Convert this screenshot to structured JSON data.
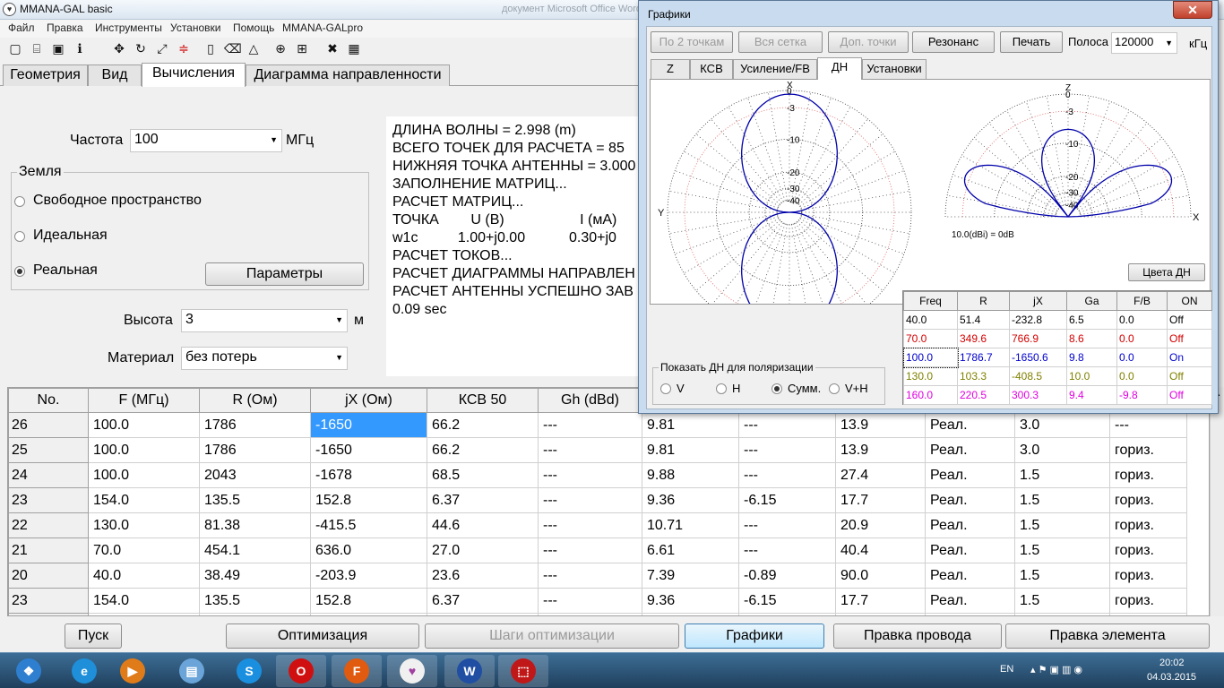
{
  "app": {
    "title": "MMANA-GAL basic",
    "ghost_title": "документ Microsoft Office Word",
    "icon_glyph": "♥"
  },
  "menu": [
    "Файл",
    "Правка",
    "Инструменты",
    "Установки",
    "Помощь",
    "MMANA-GALpro"
  ],
  "toolbar_icons": [
    "new-file-icon",
    "open-folder-icon",
    "save-icon",
    "info-icon",
    "move-icon",
    "rotate-icon",
    "resize-icon",
    "wire-edit-icon",
    "document-icon",
    "eraser-icon",
    "triangle-icon",
    "crosshair-icon",
    "tools-icon",
    "calculator-icon"
  ],
  "tabs": [
    {
      "label": "Геометрия",
      "active": false
    },
    {
      "label": "Вид",
      "active": false
    },
    {
      "label": "Вычисления",
      "active": true
    },
    {
      "label": "Диаграмма направленности",
      "active": false
    }
  ],
  "calc": {
    "freq_label": "Частота",
    "freq_value": "100",
    "freq_unit": "МГц",
    "ground_legend": "Земля",
    "ground_options": [
      {
        "label": "Свободное пространство",
        "selected": false
      },
      {
        "label": "Идеальная",
        "selected": false
      },
      {
        "label": "Реальная",
        "selected": true
      }
    ],
    "params_button": "Параметры",
    "height_label": "Высота",
    "height_value": "3",
    "height_unit": "м",
    "material_label": "Материал",
    "material_value": "без потерь"
  },
  "log_lines": [
    "ДЛИНА ВОЛНЫ = 2.998 (m)",
    "ВСЕГО ТОЧЕК ДЛЯ РАСЧЕТА = 85",
    "НИЖНЯЯ ТОЧКА АНТЕННЫ = 3.000",
    "ЗАПОЛНЕНИЕ МАТРИЦ...",
    "РАСЧЕТ МАТРИЦ...",
    "ТОЧКА        U (В)                   I (мА)",
    "w1c          1.00+j0.00           0.30+j0",
    "РАСЧЕТ ТОКОВ...",
    "РАСЧЕТ ДИАГРАММЫ НАПРАВЛЕН",
    "РАСЧЕТ АНТЕННЫ УСПЕШНО ЗАВ",
    "0.09 sec"
  ],
  "results": {
    "columns": [
      "No.",
      "F (МГц)",
      "R (Ом)",
      "jX (Ом)",
      "КСВ 50",
      "Gh (dBd)",
      "",
      "",
      "",
      "",
      "",
      ""
    ],
    "rows": [
      [
        "26",
        "100.0",
        "1786",
        "-1650",
        "66.2",
        "---",
        "9.81",
        "---",
        "13.9",
        "Реал.",
        "3.0",
        "---"
      ],
      [
        "25",
        "100.0",
        "1786",
        "-1650",
        "66.2",
        "---",
        "9.81",
        "---",
        "13.9",
        "Реал.",
        "3.0",
        "гориз."
      ],
      [
        "24",
        "100.0",
        "2043",
        "-1678",
        "68.5",
        "---",
        "9.88",
        "---",
        "27.4",
        "Реал.",
        "1.5",
        "гориз."
      ],
      [
        "23",
        "154.0",
        "135.5",
        "152.8",
        "6.37",
        "---",
        "9.36",
        "-6.15",
        "17.7",
        "Реал.",
        "1.5",
        "гориз."
      ],
      [
        "22",
        "130.0",
        "81.38",
        "-415.5",
        "44.6",
        "---",
        "10.71",
        "---",
        "20.9",
        "Реал.",
        "1.5",
        "гориз."
      ],
      [
        "21",
        "70.0",
        "454.1",
        "636.0",
        "27.0",
        "---",
        "6.61",
        "---",
        "40.4",
        "Реал.",
        "1.5",
        "гориз."
      ],
      [
        "20",
        "40.0",
        "38.49",
        "-203.9",
        "23.6",
        "---",
        "7.39",
        "-0.89",
        "90.0",
        "Реал.",
        "1.5",
        "гориз."
      ],
      [
        "23",
        "154.0",
        "135.5",
        "152.8",
        "6.37",
        "---",
        "9.36",
        "-6.15",
        "17.7",
        "Реал.",
        "1.5",
        "гориз."
      ],
      [
        "",
        "",
        "",
        "",
        "",
        "",
        "",
        "",
        "",
        "",
        "",
        ""
      ]
    ]
  },
  "bottom_buttons": [
    {
      "label": "Пуск",
      "disabled": false
    },
    {
      "label": "Оптимизация",
      "disabled": false
    },
    {
      "label": "Шаги оптимизации",
      "disabled": true
    },
    {
      "label": "Графики",
      "disabled": false
    },
    {
      "label": "Правка провода",
      "disabled": false
    },
    {
      "label": "Правка элемента",
      "disabled": false
    }
  ],
  "graph": {
    "title": "Графики",
    "close_glyph": "✕",
    "buttons": [
      {
        "label": "По 2 точкам",
        "disabled": true
      },
      {
        "label": "Вся сетка",
        "disabled": true
      },
      {
        "label": "Доп. точки",
        "disabled": true
      },
      {
        "label": "Резонанс",
        "disabled": false
      },
      {
        "label": "Печать",
        "disabled": false
      }
    ],
    "band_label": "Полоса",
    "band_value": "120000",
    "band_unit": "кГц",
    "tabs": [
      {
        "label": "Z",
        "active": false
      },
      {
        "label": "КСВ",
        "active": false
      },
      {
        "label": "Усиление/FB",
        "active": false
      },
      {
        "label": "ДН",
        "active": true
      },
      {
        "label": "Установки",
        "active": false
      }
    ],
    "az_labels": {
      "x": "X",
      "y": "Y"
    },
    "el_labels": {
      "z": "Z",
      "x": "X"
    },
    "ring_labels": [
      "0",
      "-3",
      "-10",
      "-20",
      "-30",
      "-40"
    ],
    "gain_note": "10.0(dBi) = 0dB",
    "colors_button": "Цвета ДН",
    "polarization": {
      "legend": "Показать ДН для поляризации",
      "options": [
        {
          "label": "V",
          "selected": false
        },
        {
          "label": "H",
          "selected": false
        },
        {
          "label": "Сумм.",
          "selected": true
        },
        {
          "label": "V+H",
          "selected": false
        }
      ]
    },
    "freq_table": {
      "columns": [
        "Freq",
        "R",
        "jX",
        "Ga",
        "F/B",
        "ON"
      ],
      "rows": [
        {
          "cells": [
            "40.0",
            "51.4",
            "-232.8",
            "6.5",
            "0.0",
            "Off"
          ],
          "color": "#000000"
        },
        {
          "cells": [
            "70.0",
            "349.6",
            "766.9",
            "8.6",
            "0.0",
            "Off"
          ],
          "color": "#d40000"
        },
        {
          "cells": [
            "100.0",
            "1786.7",
            "-1650.6",
            "9.8",
            "0.0",
            "On"
          ],
          "color": "#0000cc"
        },
        {
          "cells": [
            "130.0",
            "103.3",
            "-408.5",
            "10.0",
            "0.0",
            "Off"
          ],
          "color": "#808000"
        },
        {
          "cells": [
            "160.0",
            "220.5",
            "300.3",
            "9.4",
            "-9.8",
            "Off"
          ],
          "color": "#e000e0"
        }
      ]
    }
  },
  "taskbar": {
    "lang": "EN",
    "time": "20:02",
    "date": "04.03.2015",
    "apps": [
      "start-orb-icon",
      "internet-explorer-icon",
      "media-player-icon",
      "files-icon",
      "skype-icon",
      "opera-icon",
      "firefox-icon",
      "mmana-icon",
      "word-icon",
      "pdf-icon"
    ],
    "app_glyphs": [
      "❖",
      "e",
      "▶",
      "▤",
      "S",
      "O",
      "F",
      "♥",
      "W",
      "⬚"
    ],
    "app_colors": [
      "#2f7fd0",
      "#1e8fd8",
      "#e07b1a",
      "#6aa4d8",
      "#1a8fe0",
      "#d01010",
      "#e05a10",
      "#f0f0f0",
      "#1f4ea3",
      "#c01818"
    ]
  },
  "colors": {
    "selection": "#3399ff",
    "pattern_line": "#0000aa",
    "ring_red": "#e06060"
  }
}
